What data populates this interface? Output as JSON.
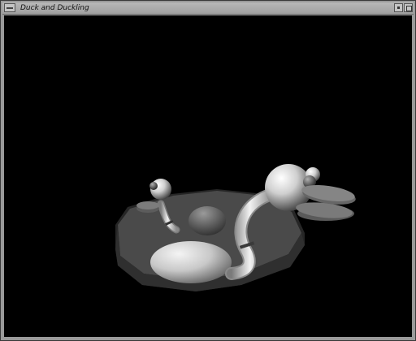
{
  "window": {
    "title": "Duck and Duckling",
    "menu_icon": "window-menu-icon",
    "iconify_icon": "iconify-icon",
    "maximize_icon": "maximize-icon"
  },
  "scene": {
    "background_color": "#000000",
    "objects": [
      "platform",
      "duckling",
      "duck",
      "egg",
      "mound"
    ]
  }
}
